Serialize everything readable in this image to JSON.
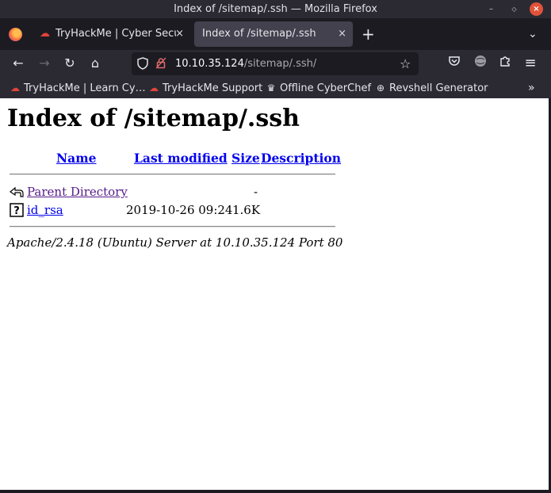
{
  "window": {
    "title": "Index of /sitemap/.ssh — Mozilla Firefox"
  },
  "tabs": [
    {
      "label": "TryHackMe | Cyber Securi",
      "close": "×"
    },
    {
      "label": "Index of /sitemap/.ssh",
      "close": "×"
    }
  ],
  "toolbar": {
    "newtab": "+",
    "tablist": "⌄",
    "back": "←",
    "forward": "→",
    "reload": "↻",
    "home": "⌂",
    "star": "☆",
    "menu": "≡"
  },
  "urlbar": {
    "host": "10.10.35.124",
    "path": "/sitemap/.ssh/"
  },
  "bookmarks": [
    {
      "label": "TryHackMe | Learn Cy…"
    },
    {
      "label": "TryHackMe Support"
    },
    {
      "label": "Offline CyberChef"
    },
    {
      "label": "Revshell Generator"
    }
  ],
  "bookmarks_more": "»",
  "page": {
    "heading": "Index of /sitemap/.ssh",
    "columns": {
      "name": "Name",
      "last_modified": "Last modified",
      "size": "Size",
      "description": "Description"
    },
    "rows": [
      {
        "name": "Parent Directory",
        "modified": "",
        "size": "-"
      },
      {
        "name": "id_rsa",
        "modified": "2019-10-26 09:24",
        "size": "1.6K"
      }
    ],
    "address": "Apache/2.4.18 (Ubuntu) Server at 10.10.35.124 Port 80"
  },
  "colors": {
    "link": "#0000ee",
    "visited": "#551a8b",
    "chrome_dark": "#1c1b22",
    "chrome": "#2b2a33"
  }
}
